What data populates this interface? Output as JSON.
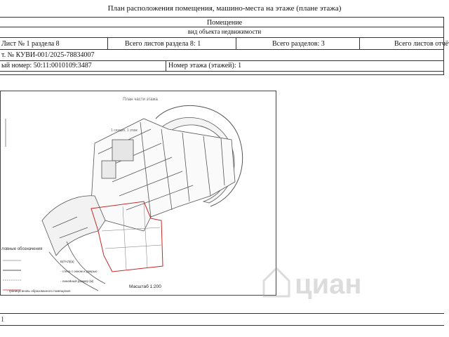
{
  "document": {
    "heading": "План расположения помещения, машино-места на этаже (плане этажа)",
    "object_label": "Помещение",
    "object_type_caption": "вид объекта недвижимости",
    "sheet_no": "Лист № 1 раздела 8",
    "sheets_in_section": "Всего листов раздела 8: 1",
    "sections_total": "Всего разделов: 3",
    "sheets_total": "Всего листов отчёта",
    "extract_no": "т. № КУВИ-001/2025-78834007",
    "cadastral_no": "ый номер: 50:11:0010109:3487",
    "floor_no": "Номер этажа (этажей): 1",
    "footer_mark": "1"
  },
  "plan": {
    "title": "План части этажа",
    "section_note": "1 секция, 1 этаж",
    "legend_title": "ловные обозначения",
    "legend_items": [
      "Б(ГАЛ)(а)",
      "- стена с окном и дверью",
      "- линейный размер (м)",
      "- граница вновь образованного помещения"
    ],
    "scale": "Масштаб 1:200",
    "colors": {
      "outline": "#c62828",
      "walls": "#555555",
      "frame": "#444444"
    }
  },
  "watermark": {
    "text": "циан"
  }
}
